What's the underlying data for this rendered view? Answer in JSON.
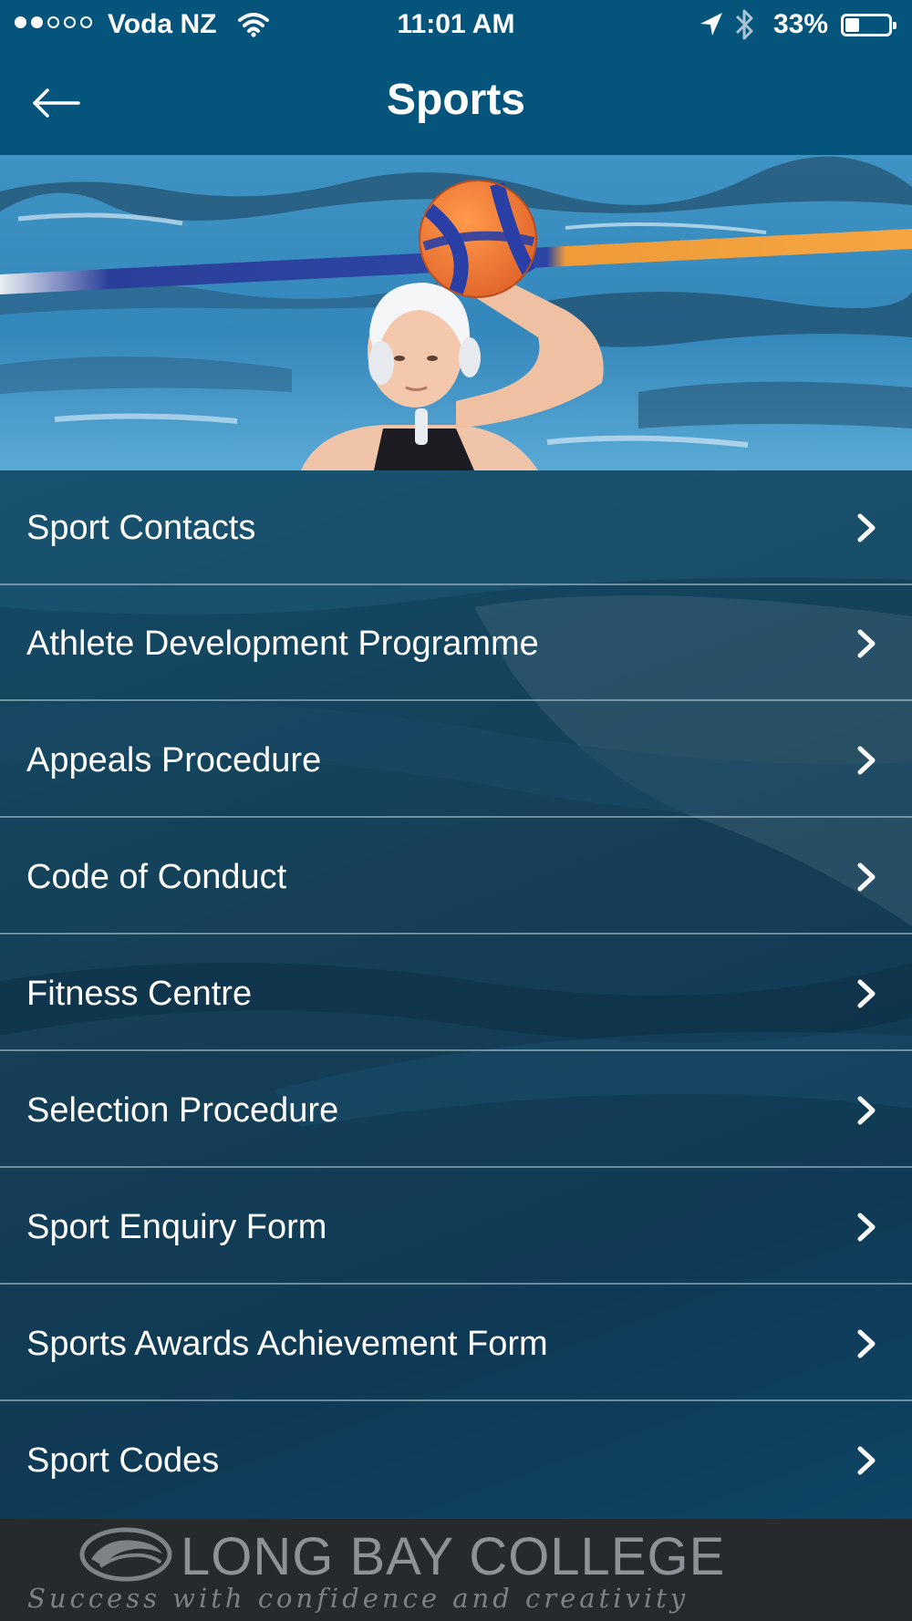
{
  "status_bar": {
    "carrier": "Voda NZ",
    "signal_bars_filled": 2,
    "signal_bars_total": 5,
    "time": "11:01 AM",
    "battery_percent_text": "33%",
    "battery_level": 0.33
  },
  "nav": {
    "title": "Sports",
    "back_icon": "arrow-left-icon"
  },
  "hero": {
    "image": "water-polo-player-photo"
  },
  "menu": {
    "items": [
      {
        "label": "Sport Contacts"
      },
      {
        "label": "Athlete Development Programme"
      },
      {
        "label": "Appeals Procedure"
      },
      {
        "label": "Code of Conduct"
      },
      {
        "label": "Fitness Centre"
      },
      {
        "label": "Selection Procedure"
      },
      {
        "label": "Sport Enquiry Form"
      },
      {
        "label": "Sports Awards Achievement Form"
      },
      {
        "label": "Sport Codes"
      }
    ],
    "chevron_icon": "chevron-right-icon"
  },
  "footer": {
    "college_name": "LONG BAY COLLEGE",
    "tagline": "Success with confidence and creativity"
  },
  "colors": {
    "bar": "#04547c",
    "row_text": "#ffffff",
    "footer_bg": "#262a2d",
    "footer_text": "#8d9296"
  }
}
